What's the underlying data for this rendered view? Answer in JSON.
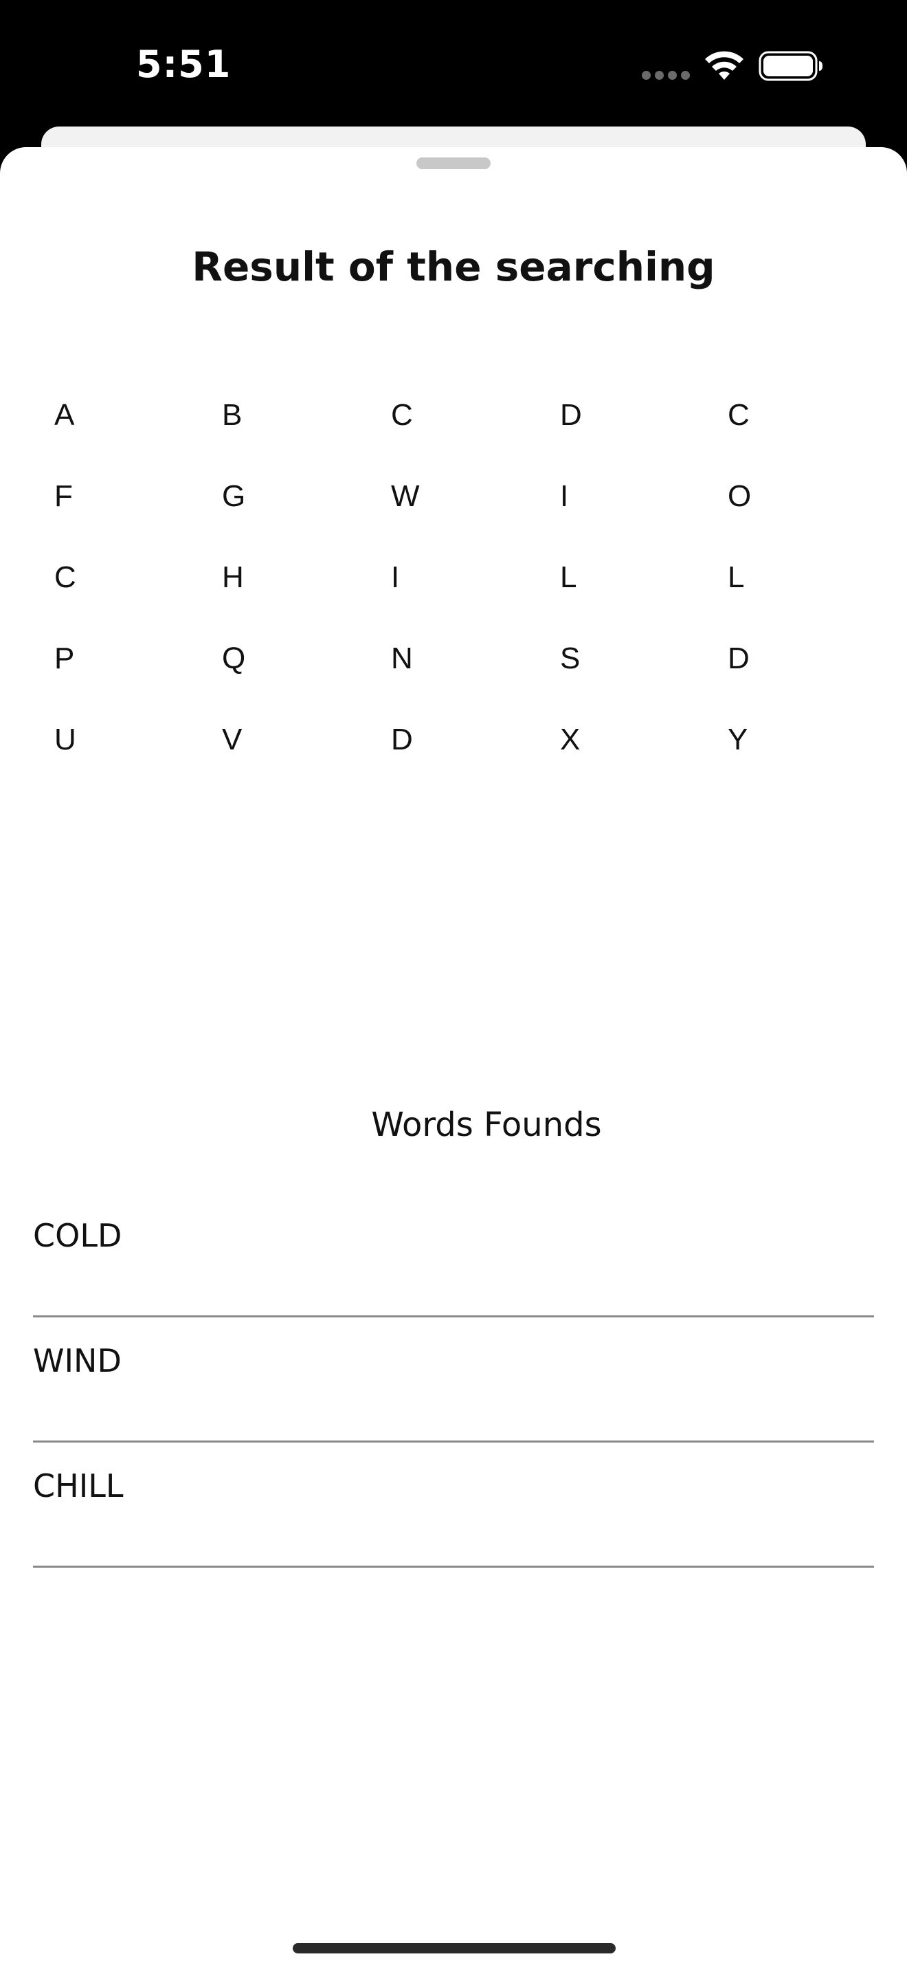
{
  "status_bar": {
    "time": "5:51",
    "signal_icon": "cell-signal-dots-icon",
    "wifi_icon": "wifi-icon",
    "battery_icon": "battery-icon"
  },
  "sheet": {
    "title": "Result of the searching",
    "grid": [
      [
        "A",
        "B",
        "C",
        "D",
        "C"
      ],
      [
        "F",
        "G",
        "W",
        "I",
        "O"
      ],
      [
        "C",
        "H",
        "I",
        "L",
        "L"
      ],
      [
        "P",
        "Q",
        "N",
        "S",
        "D"
      ],
      [
        "U",
        "V",
        "D",
        "X",
        "Y"
      ]
    ],
    "words_heading": "Words Founds",
    "words": [
      "COLD",
      "WIND",
      "CHILL"
    ]
  },
  "colors": {
    "status_background": "#000000",
    "sheet_background": "#ffffff",
    "text": "#111111",
    "separator": "#8a8a8a"
  }
}
